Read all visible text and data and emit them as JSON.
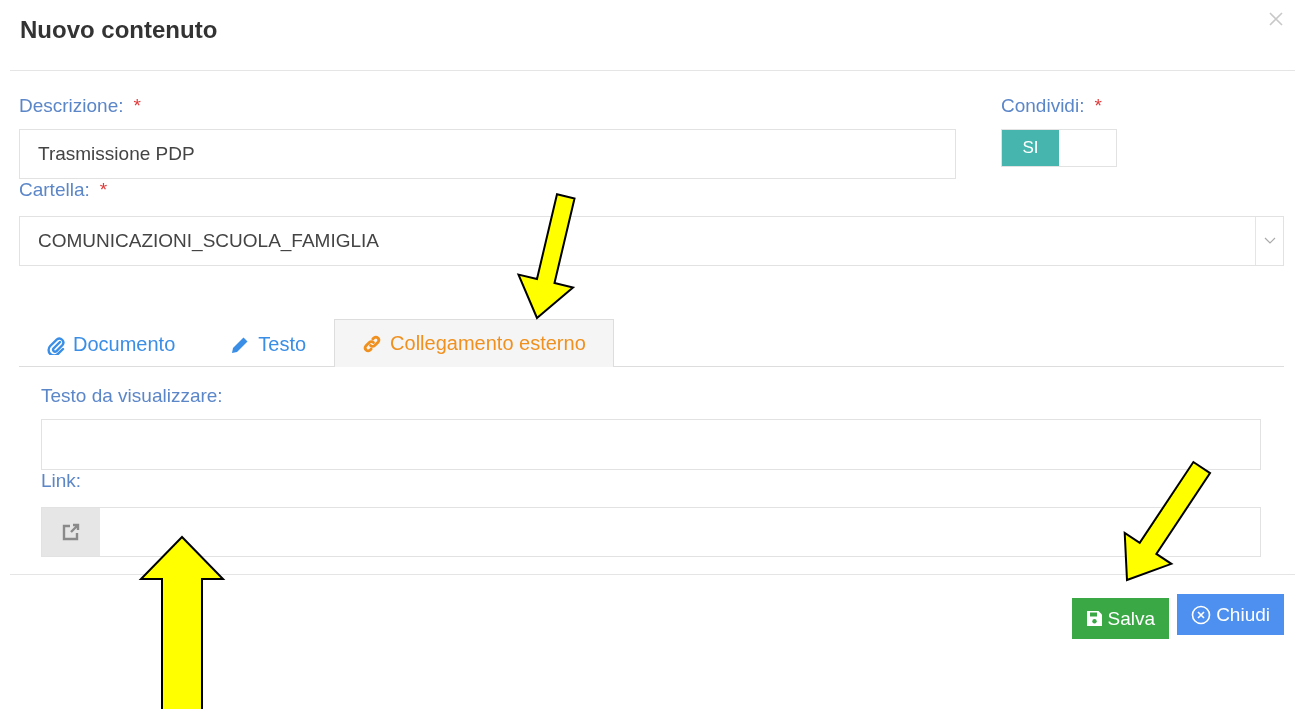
{
  "dialog": {
    "title": "Nuovo contenuto"
  },
  "description": {
    "label": "Descrizione:",
    "required_mark": "*",
    "value": "Trasmissione PDP"
  },
  "share": {
    "label": "Condividi:",
    "required_mark": "*",
    "toggle": {
      "label": "SI",
      "on": true
    }
  },
  "folder": {
    "label": "Cartella:",
    "required_mark": "*",
    "value": "COMUNICAZIONI_SCUOLA_FAMIGLIA"
  },
  "tabs": [
    {
      "label": "Documento",
      "kind": "document",
      "selected": false
    },
    {
      "label": "Testo",
      "kind": "text",
      "selected": false
    },
    {
      "label": "Collegamento esterno",
      "kind": "link",
      "selected": true
    }
  ],
  "link_fields": [
    {
      "label": "Testo da visualizzare:",
      "kind": "plain"
    },
    {
      "label": "Link:",
      "kind": "addon"
    }
  ],
  "buttons": [
    {
      "label": "Salva",
      "kind": "save"
    },
    {
      "label": "Chiudi",
      "kind": "close"
    }
  ]
}
